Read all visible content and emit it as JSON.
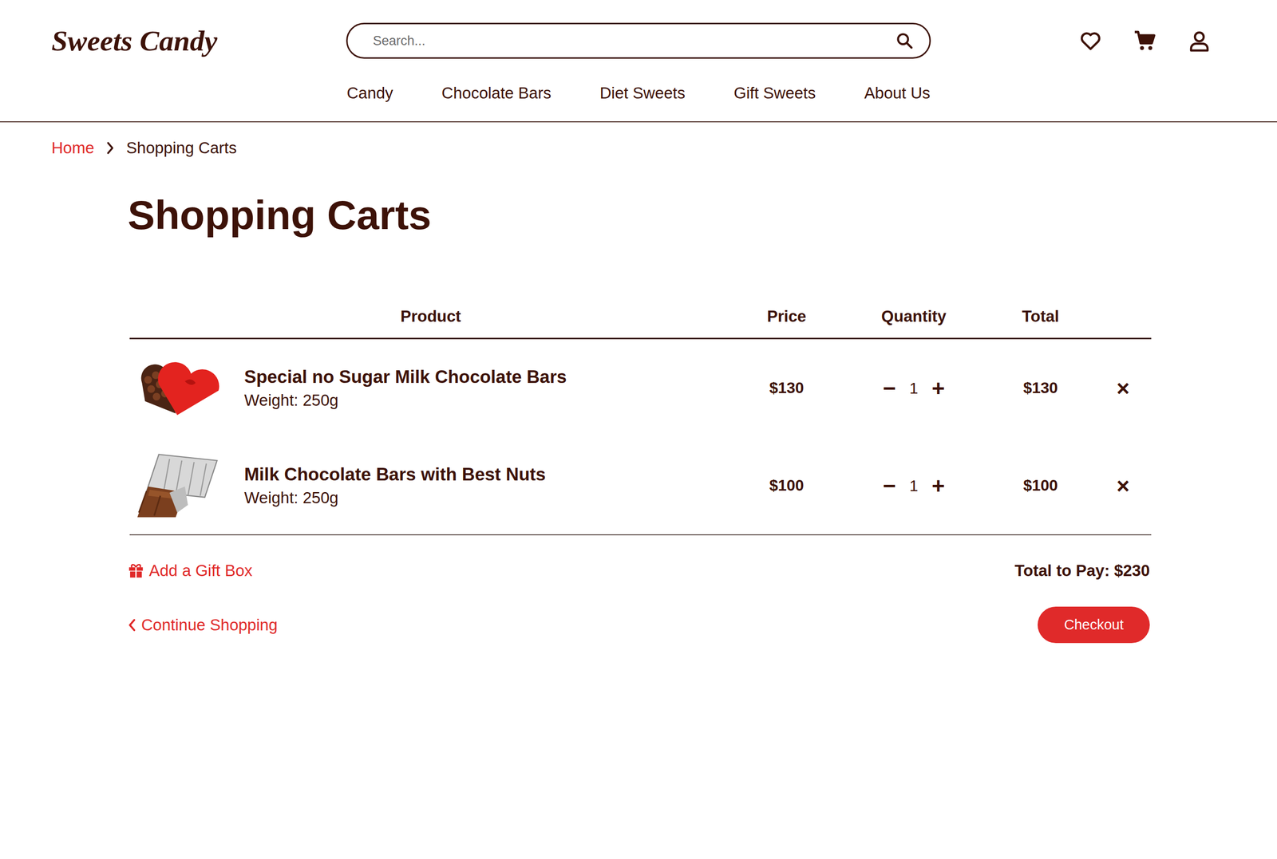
{
  "header": {
    "logo": "Sweets Candy",
    "search": {
      "placeholder": "Search..."
    },
    "nav": [
      "Candy",
      "Chocolate Bars",
      "Diet Sweets",
      "Gift Sweets",
      "About Us"
    ]
  },
  "breadcrumb": [
    {
      "label": "Home",
      "current": false
    },
    {
      "label": "Shopping Carts",
      "current": true
    }
  ],
  "title": "Shopping Carts",
  "table": {
    "columns": [
      "Product",
      "Price",
      "Quantity",
      "Total"
    ],
    "rows": [
      {
        "name": "Special no Sugar Milk Chocolate Bars",
        "weight": "Weight: 250g",
        "price": "$130",
        "quantity": "1",
        "total": "$130",
        "decrement": "−",
        "increment": "+",
        "remove": "×",
        "kind": "heart-box"
      },
      {
        "name": "Milk Chocolate Bars with Best Nuts",
        "weight": "Weight: 250g",
        "price": "$100",
        "quantity": "1",
        "total": "$100",
        "decrement": "−",
        "increment": "+",
        "remove": "×",
        "kind": "bar"
      }
    ]
  },
  "gift_box": "Add a Gift Box",
  "total_to_pay": "Total to Pay: $230",
  "continue_shopping": "Continue Shopping",
  "checkout": "Checkout"
}
